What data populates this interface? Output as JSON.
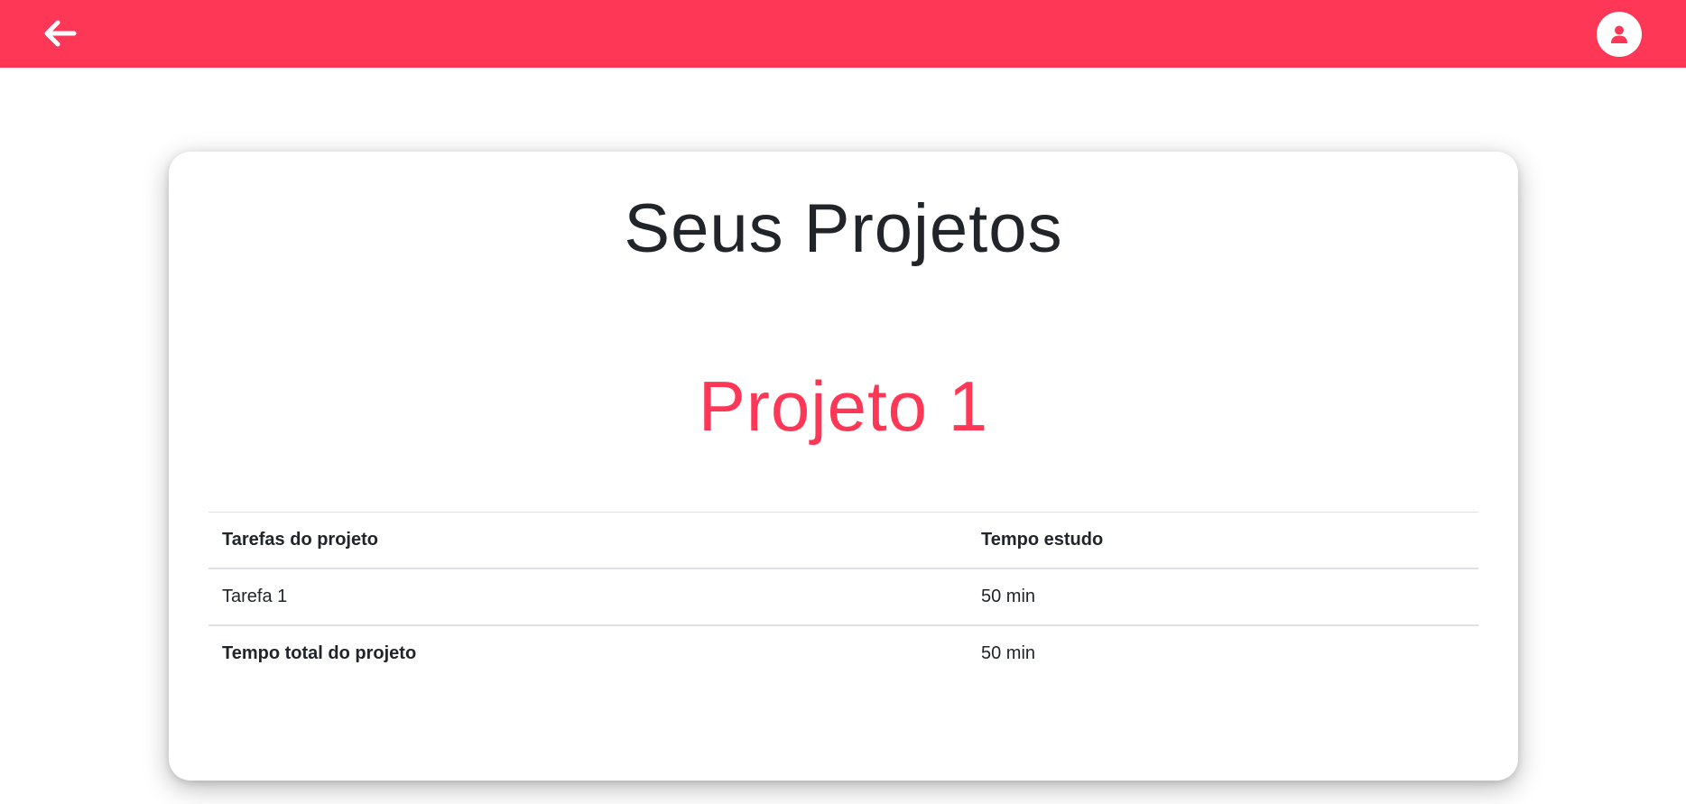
{
  "header": {
    "background_color": "#fe3757",
    "back_icon": "arrow-left-icon",
    "user_icon": "user-icon"
  },
  "page": {
    "title": "Seus Projetos"
  },
  "project": {
    "name": "Projeto 1",
    "accent_color": "#fe3757",
    "table": {
      "headers": [
        "Tarefas do projeto",
        "Tempo estudo"
      ],
      "rows": [
        [
          "Tarefa 1",
          "50 min"
        ]
      ],
      "total": {
        "label": "Tempo total do projeto",
        "value": "50 min"
      }
    }
  }
}
